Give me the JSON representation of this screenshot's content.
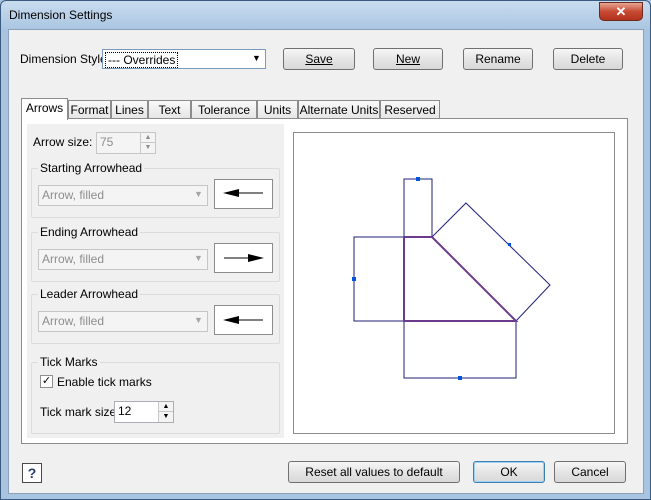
{
  "window": {
    "title": "Dimension Settings",
    "close_glyph": "✕"
  },
  "style": {
    "label": "Dimension Style:",
    "selected": "--- Overrides"
  },
  "buttons": {
    "save": "Save",
    "new": "New",
    "rename": "Rename",
    "delete": "Delete",
    "reset": "Reset all values to default",
    "ok": "OK",
    "cancel": "Cancel",
    "help": "?"
  },
  "tabs": [
    {
      "label": "Arrows",
      "active": true
    },
    {
      "label": "Format"
    },
    {
      "label": "Lines"
    },
    {
      "label": "Text"
    },
    {
      "label": "Tolerance"
    },
    {
      "label": "Units"
    },
    {
      "label": "Alternate Units"
    },
    {
      "label": "Reserved"
    }
  ],
  "arrows": {
    "arrow_size_label": "Arrow size:",
    "arrow_size_value": "75",
    "starting": {
      "title": "Starting Arrowhead",
      "value": "Arrow, filled"
    },
    "ending": {
      "title": "Ending Arrowhead",
      "value": "Arrow, filled"
    },
    "leader": {
      "title": "Leader Arrowhead",
      "value": "Arrow, filled"
    }
  },
  "ticks": {
    "title": "Tick Marks",
    "enable_label": "Enable tick marks",
    "enabled": true,
    "size_label": "Tick mark size:",
    "size_value": "12"
  },
  "icons": [
    "close-icon",
    "dropdown-arrow-icon",
    "spin-up-icon",
    "spin-down-icon",
    "checkmark-icon",
    "help-icon",
    "arrowhead-left-icon",
    "arrowhead-right-icon"
  ],
  "colors": {
    "preview_lines": "#1f1f7a",
    "preview_accent": "#6b3a8a",
    "grip": "#0055dd"
  }
}
